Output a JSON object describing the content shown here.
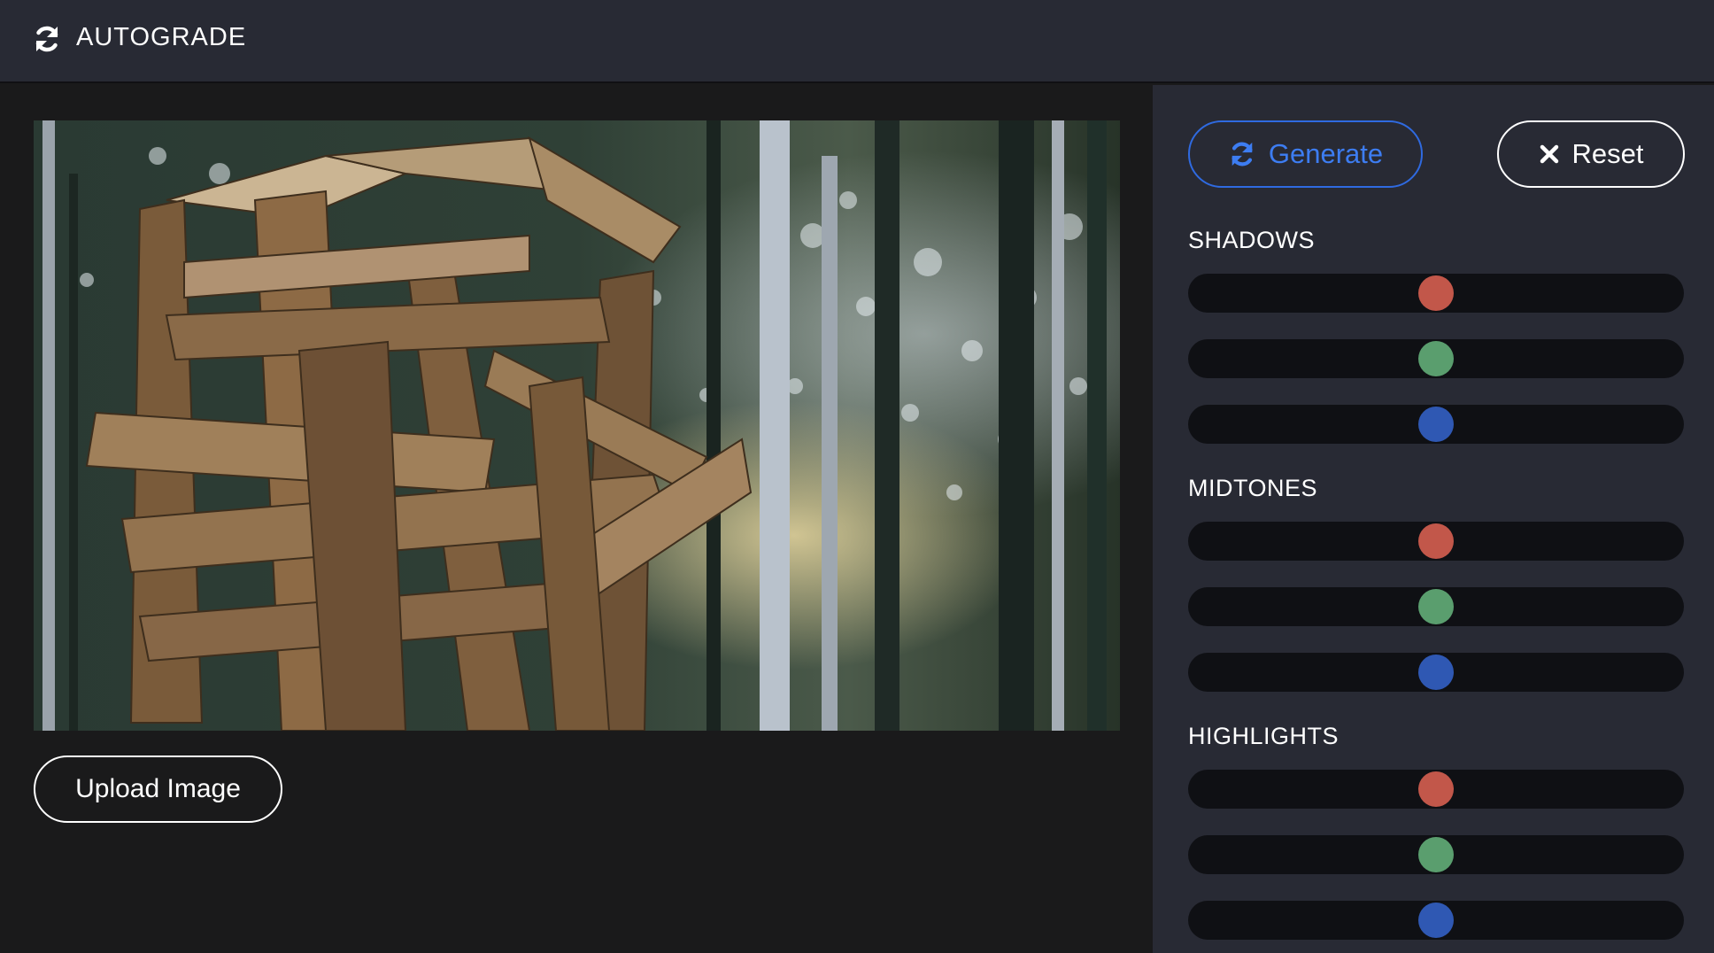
{
  "header": {
    "title": "AUTOGRADE",
    "icon": "sync-icon"
  },
  "main": {
    "upload_label": "Upload Image"
  },
  "panel": {
    "generate_label": "Generate",
    "reset_label": "Reset",
    "accent_color": "#3d7df2",
    "groups": [
      {
        "label": "SHADOWS",
        "values": {
          "red": 0.5,
          "green": 0.5,
          "blue": 0.5
        }
      },
      {
        "label": "MIDTONES",
        "values": {
          "red": 0.5,
          "green": 0.5,
          "blue": 0.5
        }
      },
      {
        "label": "HIGHLIGHTS",
        "values": {
          "red": 0.5,
          "green": 0.5,
          "blue": 0.5
        }
      }
    ],
    "channel_colors": {
      "red": "#c2574a",
      "green": "#5a9e6e",
      "blue": "#2f58b3"
    }
  }
}
